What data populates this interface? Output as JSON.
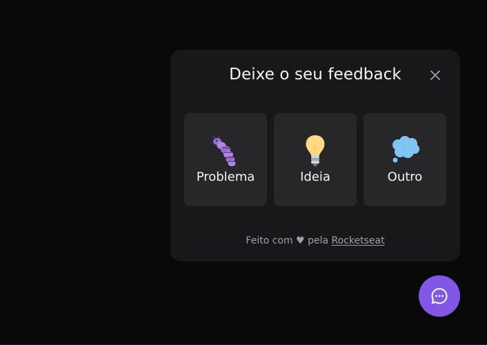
{
  "widget": {
    "title": "Deixe o seu feedback",
    "close_icon": "close-icon",
    "options": [
      {
        "label": "Problema",
        "icon": "bug-icon"
      },
      {
        "label": "Ideia",
        "icon": "lightbulb-icon"
      },
      {
        "label": "Outro",
        "icon": "thought-balloon-icon"
      }
    ],
    "footer": {
      "prefix": "Feito com",
      "heart": "♥",
      "middle": "pela",
      "link": "Rocketseat"
    }
  },
  "fab": {
    "icon": "chat-bubble-icon"
  },
  "colors": {
    "background": "#09090a",
    "card": "#18181b",
    "option_bg": "#27272a",
    "brand": "#8257e5",
    "text": "#f4f4f5",
    "muted": "#a1a1aa"
  }
}
